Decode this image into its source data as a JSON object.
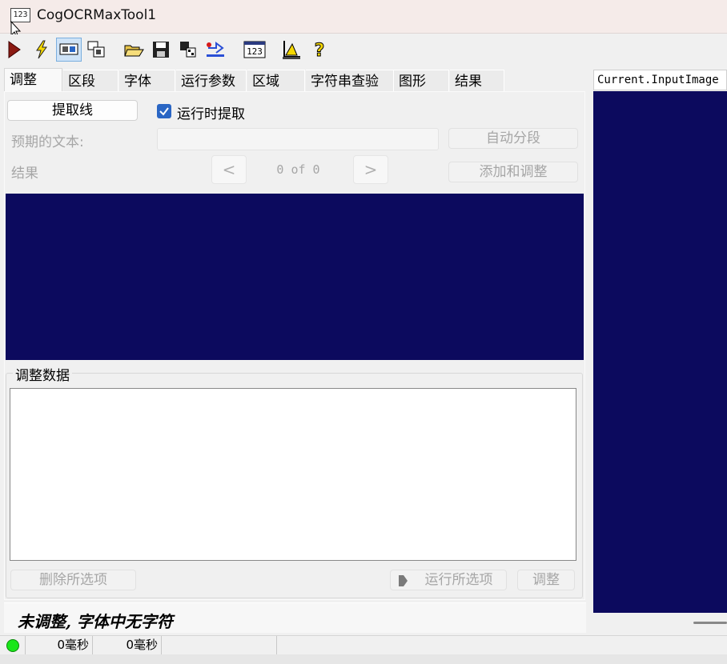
{
  "window": {
    "title": "CogOCRMaxTool1",
    "icon_text": "123"
  },
  "toolbar": {
    "buttons": [
      {
        "name": "run-icon"
      },
      {
        "name": "lightning-icon"
      },
      {
        "name": "image-toggle-icon",
        "active": true
      },
      {
        "name": "image-pin-icon"
      },
      {
        "name": "open-folder-icon"
      },
      {
        "name": "save-icon"
      },
      {
        "name": "copy-icon"
      },
      {
        "name": "reset-icon"
      },
      {
        "name": "123-icon",
        "text": "123"
      },
      {
        "name": "measure-icon"
      },
      {
        "name": "help-icon"
      }
    ]
  },
  "tabs": [
    "调整",
    "区段",
    "字体",
    "运行参数",
    "区域",
    "字符串查验",
    "图形",
    "结果"
  ],
  "tune": {
    "extract_button": "提取线",
    "extract_on_run_label": "运行时提取",
    "expected_text_label": "预期的文本:",
    "auto_segment_button": "自动分段",
    "result_label": "结果",
    "prev_label": "<",
    "next_label": ">",
    "page_counter": "0 of 0",
    "add_tune_button": "添加和调整"
  },
  "tune_data": {
    "group_label": "调整数据",
    "delete_selected_button": "删除所选项",
    "run_selected_button": "运行所选项",
    "tune_button": "调整"
  },
  "status_message": "未调整, 字体中无字符",
  "statusbar": {
    "time1": "0毫秒",
    "time2": "0毫秒"
  },
  "image_panel": {
    "header": "Current.InputImage"
  },
  "colors": {
    "display_bg": "#0c0a5e",
    "led": "#19e619",
    "checkbox": "#2a66c4"
  }
}
